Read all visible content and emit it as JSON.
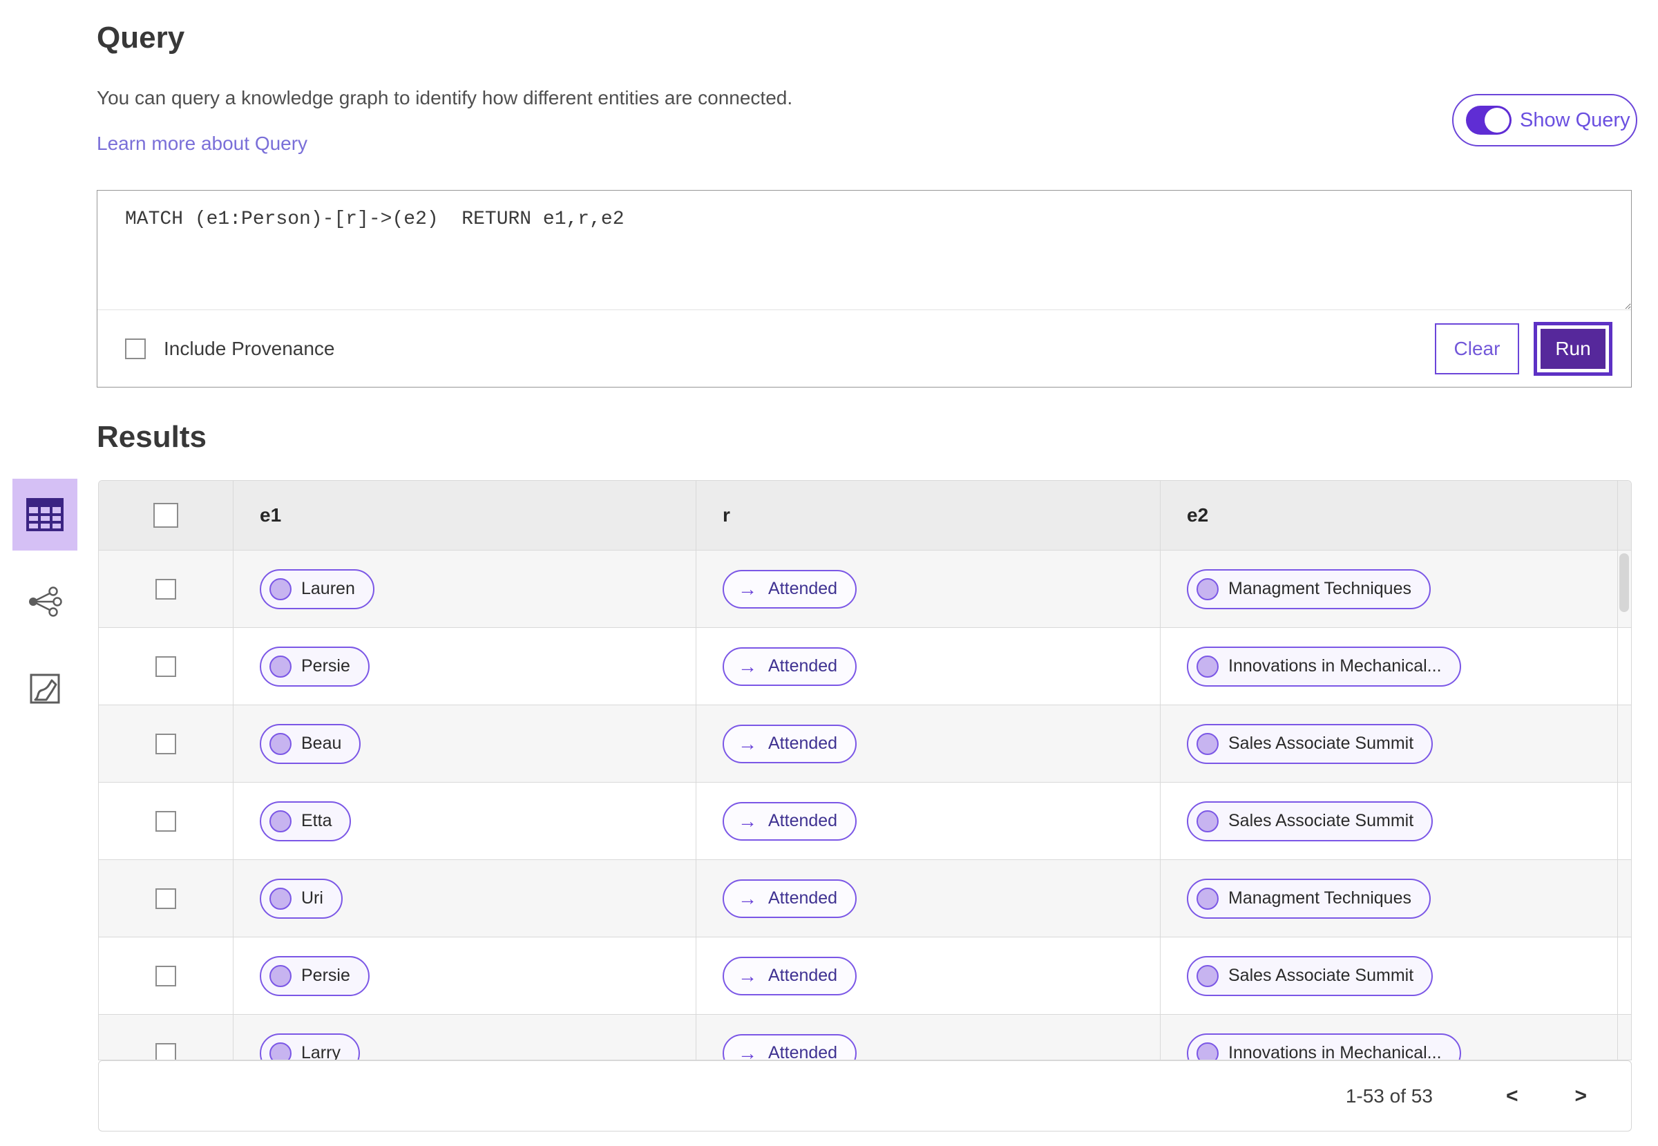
{
  "query_section": {
    "title": "Query",
    "description": "You can query a knowledge graph to identify how different entities are connected.",
    "learn_more_label": "Learn more about Query",
    "show_query_label": "Show Query",
    "show_query_toggle_state": "on",
    "query_text": "MATCH (e1:Person)-[r]->(e2)  RETURN e1,r,e2",
    "include_provenance_label": "Include Provenance",
    "include_provenance_checked": false,
    "clear_label": "Clear",
    "run_label": "Run"
  },
  "results_section": {
    "title": "Results",
    "relation_arrow": "→",
    "view_switcher": {
      "selected": "table-view",
      "items": [
        "table-view",
        "network-view",
        "map-view"
      ]
    },
    "table": {
      "columns": [
        "e1",
        "r",
        "e2"
      ],
      "rows": [
        {
          "e1": "Lauren",
          "r": "Attended",
          "e2": "Managment Techniques"
        },
        {
          "e1": "Persie",
          "r": "Attended",
          "e2": "Innovations in Mechanical..."
        },
        {
          "e1": "Beau",
          "r": "Attended",
          "e2": "Sales Associate Summit"
        },
        {
          "e1": "Etta",
          "r": "Attended",
          "e2": "Sales Associate Summit"
        },
        {
          "e1": "Uri",
          "r": "Attended",
          "e2": "Managment Techniques"
        },
        {
          "e1": "Persie",
          "r": "Attended",
          "e2": "Sales Associate Summit"
        },
        {
          "e1": "Larry",
          "r": "Attended",
          "e2": "Innovations in Mechanical..."
        }
      ]
    },
    "pagination": {
      "range_label": "1-53 of 53",
      "prev_label": "<",
      "next_label": ">"
    }
  },
  "colors": {
    "accent_purple": "#6b45d9",
    "run_button_fill": "#56289b",
    "toggle_fill": "#5f2dd4",
    "selected_view_bg": "#d5c0f5",
    "link_purple": "#7a6fd8",
    "pill_bg": "#f8f6fe",
    "pill_dot": "#c7b4f0",
    "table_header_bg": "#ececec",
    "row_alt_bg": "#f6f6f6"
  }
}
